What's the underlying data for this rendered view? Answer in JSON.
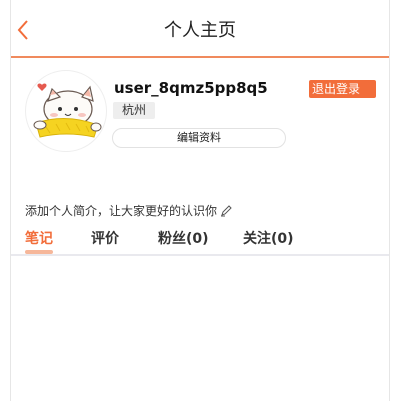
{
  "header": {
    "title": "个人主页"
  },
  "profile": {
    "username": "user_8qmz5pp8q5",
    "city": "杭州",
    "logout_label": "退出登录",
    "edit_label": "编辑资料",
    "bio_prompt": "添加个人简介，让大家更好的认识你"
  },
  "tabs": [
    {
      "label": "笔记",
      "active": true
    },
    {
      "label": "评价",
      "active": false
    },
    {
      "label": "粉丝(0)",
      "active": false
    },
    {
      "label": "关注(0)",
      "active": false
    }
  ],
  "colors": {
    "accent": "#f26d3a",
    "header_line": "#f08a5d"
  },
  "icons": {
    "back": "chevron-left-icon",
    "avatar": "cat-avatar",
    "edit": "pencil-icon"
  }
}
